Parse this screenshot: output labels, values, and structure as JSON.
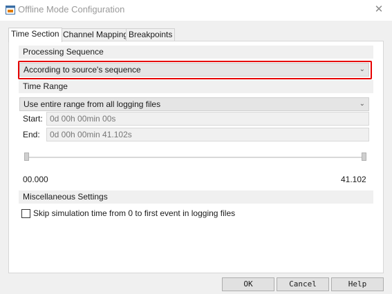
{
  "window": {
    "title": "Offline Mode Configuration",
    "icon": "app-icon",
    "close_icon": "close-icon"
  },
  "tabs": [
    {
      "label": "Time Section",
      "active": true
    },
    {
      "label": "Channel Mapping",
      "active": false
    },
    {
      "label": "Breakpoints",
      "active": false
    }
  ],
  "processing_sequence": {
    "header": "Processing Sequence",
    "selected": "According to source's sequence",
    "highlight_color": "#e60000"
  },
  "time_range": {
    "header": "Time Range",
    "selected": "Use entire range from all logging files",
    "start_label": "Start:",
    "start_value": "0d 00h 00min 00s",
    "end_label": "End:",
    "end_value": "0d 00h 00min 41.102s",
    "min_label": "00.000",
    "max_label": "41.102"
  },
  "misc": {
    "header": "Miscellaneous Settings",
    "skip_label": "Skip simulation time from 0 to first event in logging files",
    "skip_checked": false
  },
  "buttons": {
    "ok": "OK",
    "cancel": "Cancel",
    "help": "Help"
  }
}
